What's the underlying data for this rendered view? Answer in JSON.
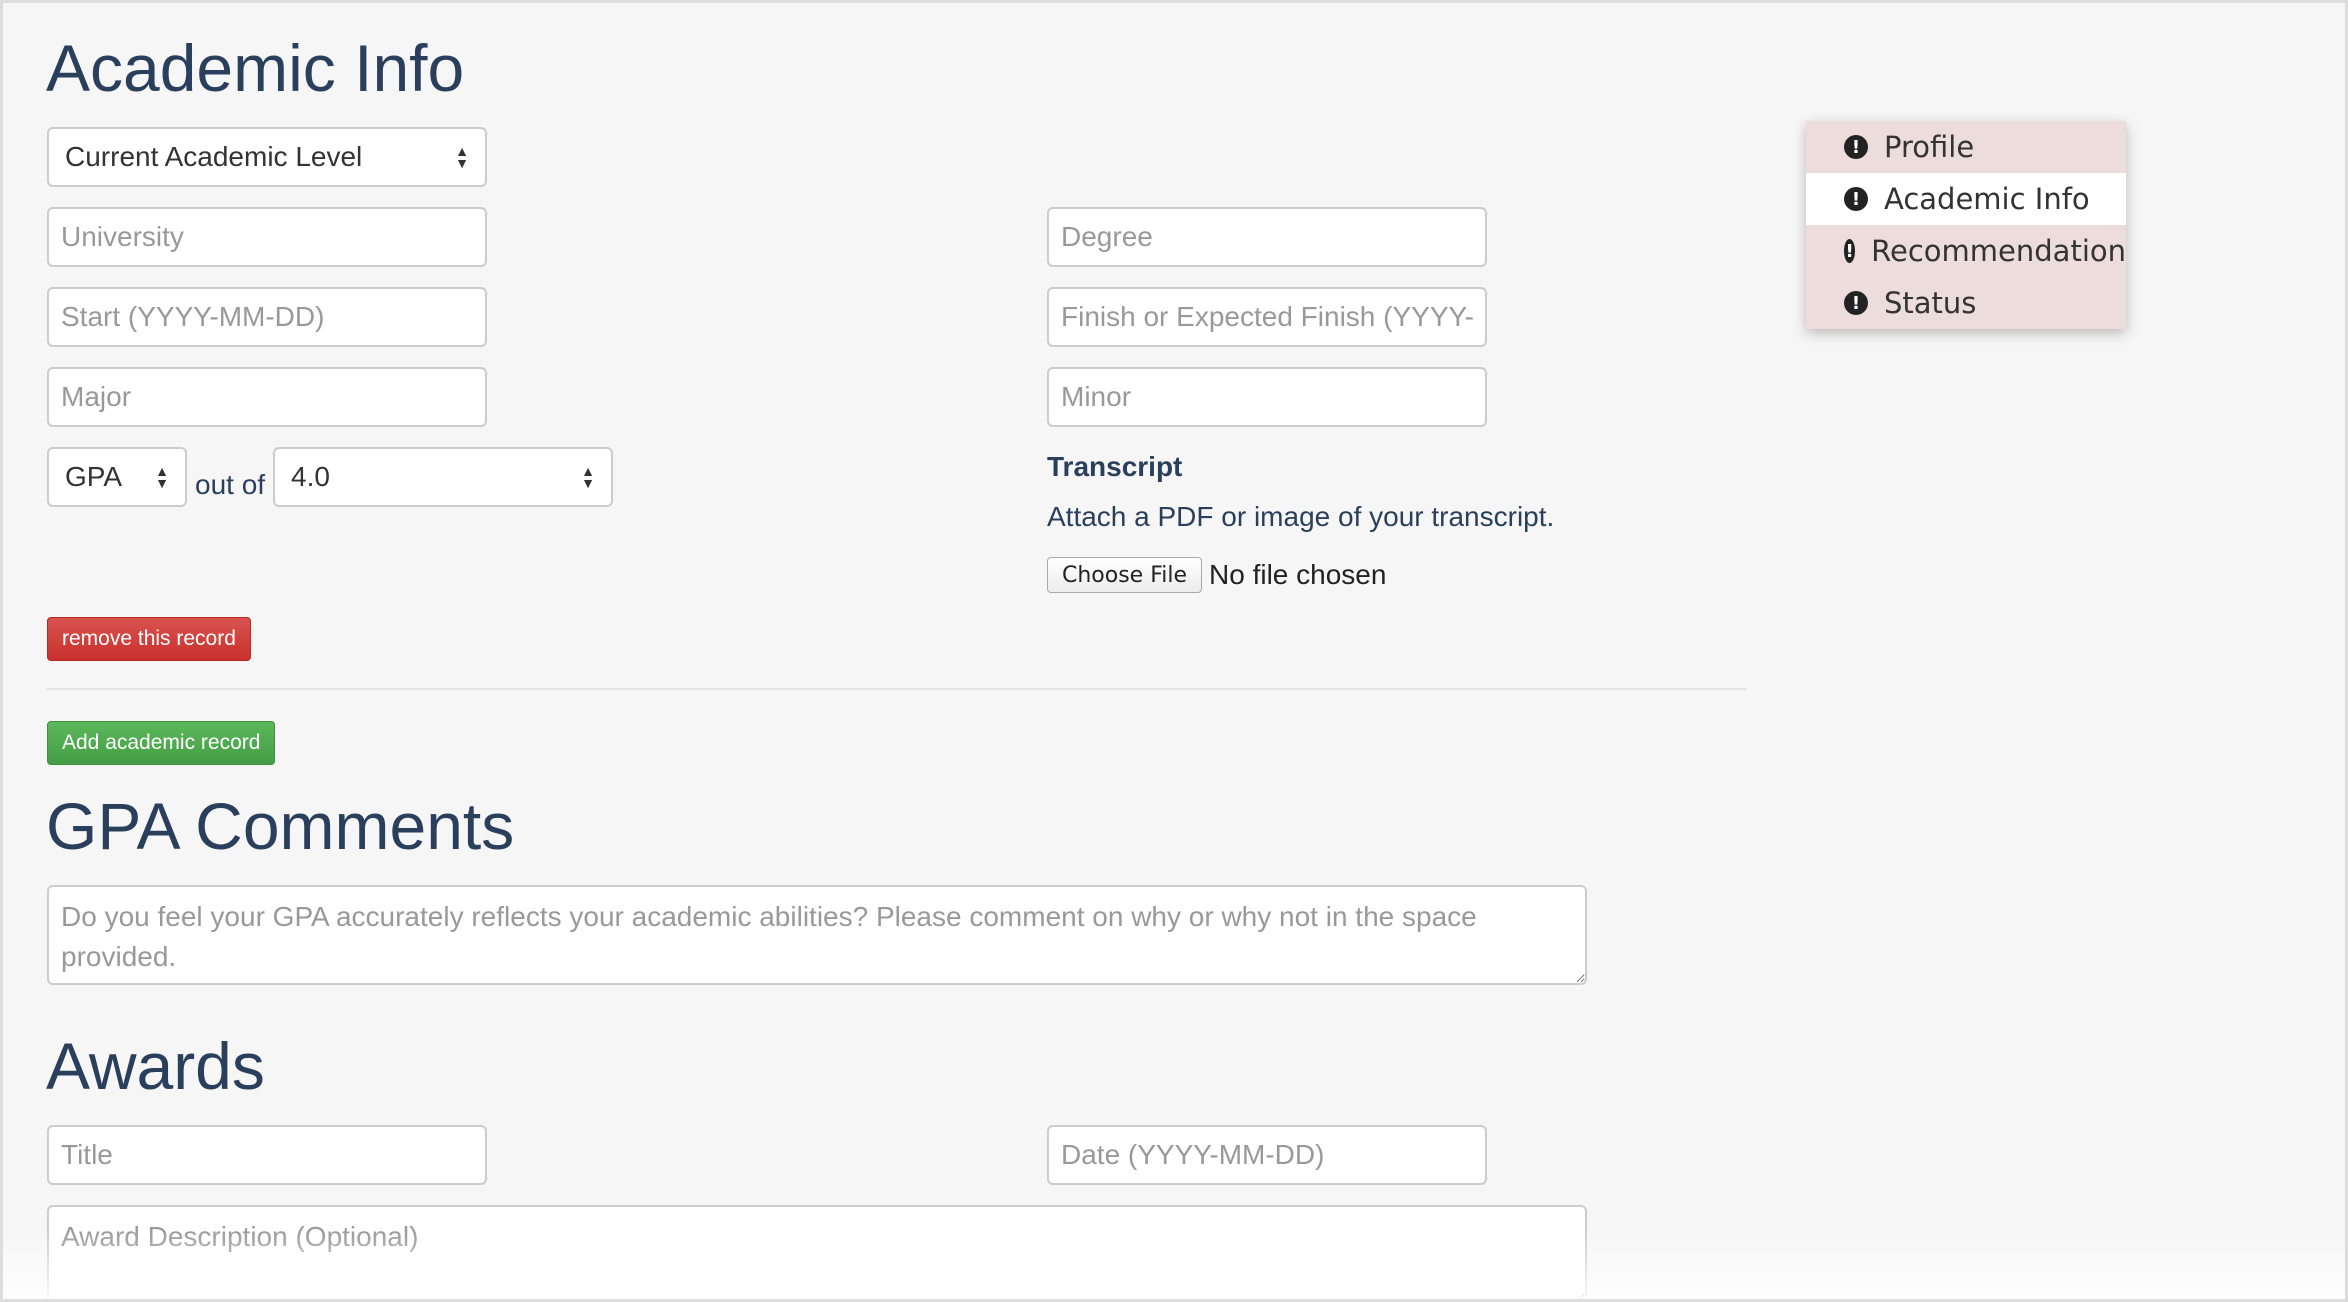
{
  "sections": {
    "academic": "Academic Info",
    "gpa_comments": "GPA Comments",
    "awards": "Awards"
  },
  "academic_record": {
    "level_select": "Current Academic Level",
    "university_placeholder": "University",
    "degree_placeholder": "Degree",
    "start_placeholder": "Start (YYYY-MM-DD)",
    "finish_placeholder": "Finish or Expected Finish (YYYY-MM-DD)",
    "major_placeholder": "Major",
    "minor_placeholder": "Minor",
    "gpa_select": "GPA",
    "out_of": "out of",
    "scale_select": "4.0",
    "transcript_label": "Transcript",
    "transcript_help": "Attach a PDF or image of your transcript.",
    "choose_file": "Choose File",
    "no_file": "No file chosen",
    "remove_button": "remove this record"
  },
  "add_record_button": "Add academic record",
  "gpa_comments_placeholder": "Do you feel your GPA accurately reflects your academic abilities? Please comment on why or why not in the space provided.",
  "awards": {
    "title_placeholder": "Title",
    "date_placeholder": "Date (YYYY-MM-DD)",
    "description_placeholder": "Award Description (Optional)"
  },
  "nav": {
    "items": [
      {
        "label": "Profile",
        "icon": "exclamation-circle-icon"
      },
      {
        "label": "Academic Info",
        "icon": "exclamation-circle-icon"
      },
      {
        "label": "Recommendation",
        "icon": "exclamation-circle-icon"
      },
      {
        "label": "Status",
        "icon": "exclamation-circle-icon"
      }
    ],
    "active_index": 1
  },
  "colors": {
    "heading": "#2a3f5c",
    "danger": "#d9534f",
    "success": "#5cb85c",
    "nav_bg": "#eddcdc"
  }
}
